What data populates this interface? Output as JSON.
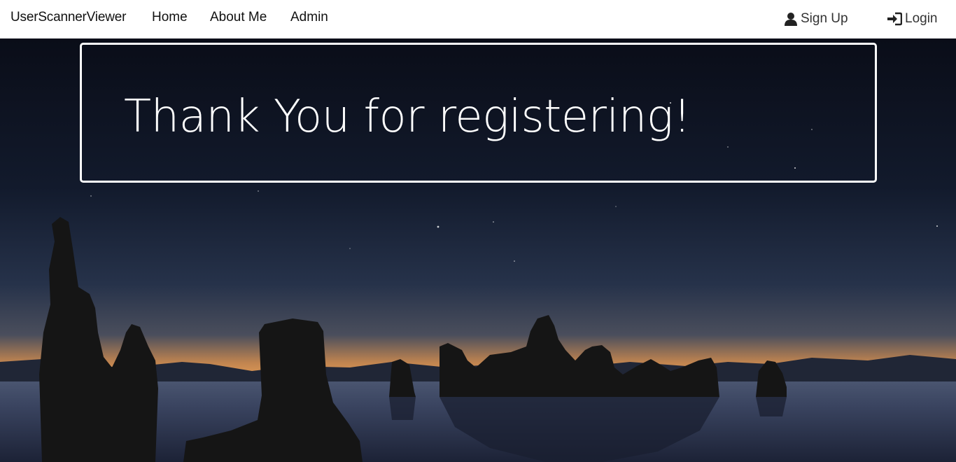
{
  "navbar": {
    "brand": "UserScannerViewer",
    "links": [
      {
        "label": "Home"
      },
      {
        "label": "About Me"
      },
      {
        "label": "Admin"
      }
    ],
    "signup": {
      "label": "Sign Up",
      "icon": "user-icon"
    },
    "login": {
      "label": "Login",
      "icon": "login-icon"
    }
  },
  "main": {
    "heading": "Thank You for registering!"
  },
  "colors": {
    "navbar_bg": "#ffffff",
    "sky_top": "#0b0f1c",
    "horizon_glow": "#d88f4c",
    "heading_text": "#ffffff"
  }
}
